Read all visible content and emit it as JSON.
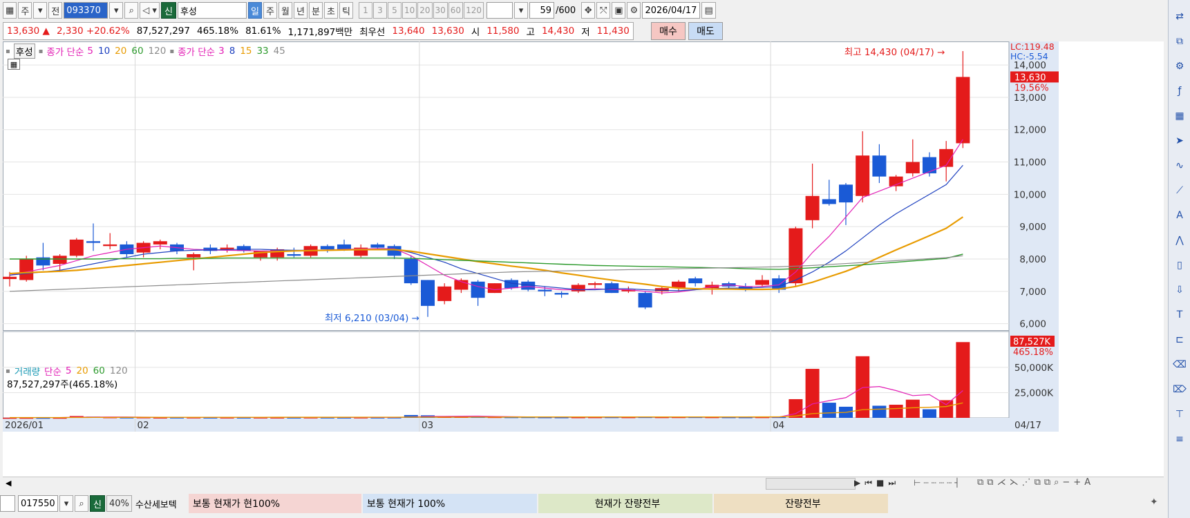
{
  "toolbar": {
    "type_label": "주",
    "prev_label": "전",
    "code": "093370",
    "shin_label": "신",
    "name": "후성",
    "periods": [
      "일",
      "주",
      "월",
      "년",
      "분",
      "초",
      "틱"
    ],
    "active_period": "일",
    "intervals": [
      "1",
      "3",
      "5",
      "10",
      "20",
      "30",
      "60",
      "120"
    ],
    "count": "59",
    "count_max": "/600",
    "date": "2026/04/17"
  },
  "quote": {
    "price": "13,630",
    "arrow": "▲",
    "change": "2,330",
    "change_pct": "+20.62%",
    "volume": "87,527,297",
    "vol_ratio": "465.18%",
    "rate2": "81.61%",
    "amount": "1,171,897백만",
    "best_label": "최우선",
    "ask": "13,640",
    "bid": "13,630",
    "open_label": "시",
    "open": "11,580",
    "high_label": "고",
    "high": "14,430",
    "low_label": "저",
    "low": "11,430",
    "buy_label": "매수",
    "sell_label": "매도"
  },
  "legend": {
    "price_name": "후성",
    "ma_group1_label": "종가 단순",
    "ma_group1": [
      "5",
      "10",
      "20",
      "60",
      "120"
    ],
    "ma_group2_label": "종가 단순",
    "ma_group2": [
      "3",
      "8",
      "15",
      "33",
      "45"
    ],
    "vol_label": "거래량",
    "vol_ma_label": "단순",
    "vol_ma": [
      "5",
      "20",
      "60",
      "120"
    ],
    "vol_info": "87,527,297주(465.18%)"
  },
  "annotations": {
    "high_note": "최고 14,430 (04/17)",
    "low_note": "최저 6,210 (03/04)",
    "lc": "LC:119.48",
    "hc": "HC:-5.54",
    "price_tag": "13,630",
    "price_tag_pct": "19.56%",
    "vol_tag": "87,527K",
    "vol_tag_pct": "465.18%"
  },
  "colors": {
    "up": "#e41b1b",
    "down": "#1a5ad6",
    "ma5": "#e21fb5",
    "ma10": "#1c3fbf",
    "ma20": "#e89b00",
    "ma60": "#2c9a2c",
    "ma120": "#8a8a8a"
  },
  "chart_data": {
    "type": "candlestick",
    "price_axis": {
      "ticks": [
        6000,
        7000,
        8000,
        9000,
        10000,
        11000,
        12000,
        13000,
        14000
      ],
      "range": [
        5800,
        14600
      ]
    },
    "volume_axis": {
      "ticks": [
        "25,000K",
        "50,000K"
      ],
      "tick_values": [
        25000,
        50000
      ],
      "range": [
        0,
        80000
      ]
    },
    "x_labels": [
      "2026/01",
      "02",
      "03",
      "04",
      "04/17"
    ],
    "candles": [
      {
        "o": 7380,
        "h": 7600,
        "l": 7150,
        "c": 7450
      },
      {
        "o": 7350,
        "h": 8100,
        "l": 7300,
        "c": 8000
      },
      {
        "o": 8050,
        "h": 8500,
        "l": 7650,
        "c": 7800
      },
      {
        "o": 7850,
        "h": 8150,
        "l": 7600,
        "c": 8100
      },
      {
        "o": 8100,
        "h": 8650,
        "l": 8050,
        "c": 8600
      },
      {
        "o": 8550,
        "h": 9100,
        "l": 8250,
        "c": 8500
      },
      {
        "o": 8400,
        "h": 8800,
        "l": 8300,
        "c": 8450
      },
      {
        "o": 8450,
        "h": 8550,
        "l": 8050,
        "c": 8150
      },
      {
        "o": 8200,
        "h": 8550,
        "l": 8050,
        "c": 8500
      },
      {
        "o": 8450,
        "h": 8600,
        "l": 8300,
        "c": 8550
      },
      {
        "o": 8450,
        "h": 8500,
        "l": 8150,
        "c": 8250
      },
      {
        "o": 8050,
        "h": 8200,
        "l": 7650,
        "c": 8150
      },
      {
        "o": 8350,
        "h": 8450,
        "l": 8150,
        "c": 8250
      },
      {
        "o": 8300,
        "h": 8450,
        "l": 8200,
        "c": 8350
      },
      {
        "o": 8400,
        "h": 8450,
        "l": 8200,
        "c": 8250
      },
      {
        "o": 8050,
        "h": 8250,
        "l": 7950,
        "c": 8250
      },
      {
        "o": 8050,
        "h": 8350,
        "l": 7950,
        "c": 8300
      },
      {
        "o": 8150,
        "h": 8350,
        "l": 8050,
        "c": 8100
      },
      {
        "o": 8100,
        "h": 8450,
        "l": 8050,
        "c": 8400
      },
      {
        "o": 8400,
        "h": 8450,
        "l": 8200,
        "c": 8300
      },
      {
        "o": 8450,
        "h": 8600,
        "l": 8250,
        "c": 8300
      },
      {
        "o": 8100,
        "h": 8450,
        "l": 8050,
        "c": 8350
      },
      {
        "o": 8450,
        "h": 8500,
        "l": 8300,
        "c": 8350
      },
      {
        "o": 8400,
        "h": 8450,
        "l": 8000,
        "c": 8100
      },
      {
        "o": 8000,
        "h": 8100,
        "l": 7200,
        "c": 7250
      },
      {
        "o": 7350,
        "h": 7350,
        "l": 6210,
        "c": 6550
      },
      {
        "o": 6700,
        "h": 7250,
        "l": 6600,
        "c": 7150
      },
      {
        "o": 7050,
        "h": 7400,
        "l": 6950,
        "c": 7350
      },
      {
        "o": 7300,
        "h": 7350,
        "l": 6550,
        "c": 6800
      },
      {
        "o": 6950,
        "h": 7250,
        "l": 6950,
        "c": 7250
      },
      {
        "o": 7350,
        "h": 7400,
        "l": 7050,
        "c": 7100
      },
      {
        "o": 7300,
        "h": 7350,
        "l": 7000,
        "c": 7050
      },
      {
        "o": 7050,
        "h": 7150,
        "l": 6850,
        "c": 7000
      },
      {
        "o": 6950,
        "h": 7000,
        "l": 6800,
        "c": 6900
      },
      {
        "o": 7000,
        "h": 7250,
        "l": 6950,
        "c": 7200
      },
      {
        "o": 7200,
        "h": 7300,
        "l": 7100,
        "c": 7250
      },
      {
        "o": 7250,
        "h": 7300,
        "l": 6950,
        "c": 6950
      },
      {
        "o": 7000,
        "h": 7150,
        "l": 6950,
        "c": 7050
      },
      {
        "o": 6950,
        "h": 7000,
        "l": 6450,
        "c": 6500
      },
      {
        "o": 7000,
        "h": 7150,
        "l": 6900,
        "c": 7100
      },
      {
        "o": 7100,
        "h": 7350,
        "l": 7000,
        "c": 7300
      },
      {
        "o": 7400,
        "h": 7450,
        "l": 7150,
        "c": 7250
      },
      {
        "o": 7100,
        "h": 7300,
        "l": 6900,
        "c": 7200
      },
      {
        "o": 7250,
        "h": 7300,
        "l": 7050,
        "c": 7150
      },
      {
        "o": 7150,
        "h": 7250,
        "l": 7000,
        "c": 7050
      },
      {
        "o": 7200,
        "h": 7500,
        "l": 7150,
        "c": 7350
      },
      {
        "o": 7400,
        "h": 7500,
        "l": 6950,
        "c": 7050
      },
      {
        "o": 7250,
        "h": 9000,
        "l": 7150,
        "c": 8950
      },
      {
        "o": 9200,
        "h": 10950,
        "l": 8950,
        "c": 9950
      },
      {
        "o": 9850,
        "h": 10450,
        "l": 9650,
        "c": 9700
      },
      {
        "o": 10300,
        "h": 10350,
        "l": 9050,
        "c": 9750
      },
      {
        "o": 9950,
        "h": 11950,
        "l": 9750,
        "c": 11200
      },
      {
        "o": 11200,
        "h": 11550,
        "l": 10350,
        "c": 10550
      },
      {
        "o": 10250,
        "h": 10600,
        "l": 10100,
        "c": 10550
      },
      {
        "o": 10650,
        "h": 11700,
        "l": 10550,
        "c": 11000
      },
      {
        "o": 11150,
        "h": 11300,
        "l": 10550,
        "c": 10650
      },
      {
        "o": 10850,
        "h": 11650,
        "l": 10400,
        "c": 11400
      },
      {
        "o": 11580,
        "h": 14430,
        "l": 11430,
        "c": 13630
      }
    ],
    "volumes": [
      120,
      150,
      130,
      180,
      1800,
      1200,
      700,
      500,
      600,
      400,
      450,
      500,
      400,
      450,
      400,
      450,
      420,
      400,
      500,
      450,
      400,
      500,
      450,
      500,
      2800,
      2500,
      1500,
      1200,
      1000,
      900,
      800,
      850,
      700,
      650,
      700,
      750,
      800,
      750,
      900,
      800,
      850,
      900,
      800,
      750,
      700,
      800,
      900,
      18500,
      48500,
      15000,
      11000,
      61000,
      12000,
      13000,
      18000,
      8500,
      17500,
      75000
    ],
    "ma_lines": {
      "ma5": [
        7500,
        7600,
        7700,
        7800,
        7950,
        8100,
        8200,
        8300,
        8350,
        8400,
        8350,
        8300,
        8280,
        8270,
        8260,
        8250,
        8250,
        8250,
        8270,
        8280,
        8300,
        8310,
        8320,
        8320,
        8100,
        7800,
        7500,
        7300,
        7150,
        7050,
        7100,
        7150,
        7100,
        7050,
        7050,
        7080,
        7060,
        7050,
        7000,
        6950,
        6980,
        7050,
        7150,
        7200,
        7150,
        7150,
        7200,
        7600,
        8200,
        8700,
        9300,
        9900,
        10100,
        10300,
        10500,
        10700,
        10900,
        11700
      ],
      "ma10": [
        7500,
        7550,
        7600,
        7650,
        7750,
        7850,
        7950,
        8050,
        8150,
        8200,
        8250,
        8270,
        8280,
        8290,
        8300,
        8300,
        8280,
        8270,
        8270,
        8270,
        8280,
        8290,
        8300,
        8310,
        8200,
        8050,
        7900,
        7700,
        7550,
        7400,
        7250,
        7200,
        7150,
        7100,
        7050,
        7050,
        7080,
        7080,
        7050,
        7030,
        7020,
        7050,
        7080,
        7100,
        7100,
        7120,
        7150,
        7350,
        7600,
        7900,
        8250,
        8650,
        9050,
        9400,
        9700,
        10000,
        10300,
        10900
      ],
      "ma20": [
        7550,
        7580,
        7600,
        7620,
        7650,
        7700,
        7750,
        7800,
        7850,
        7900,
        7950,
        8000,
        8050,
        8100,
        8150,
        8200,
        8230,
        8250,
        8260,
        8270,
        8280,
        8290,
        8290,
        8290,
        8240,
        8160,
        8080,
        8000,
        7920,
        7850,
        7780,
        7720,
        7650,
        7570,
        7500,
        7420,
        7350,
        7280,
        7220,
        7150,
        7100,
        7080,
        7070,
        7070,
        7060,
        7060,
        7070,
        7150,
        7280,
        7450,
        7620,
        7820,
        8050,
        8280,
        8500,
        8720,
        8950,
        9300
      ],
      "ma60": [
        8000,
        8000,
        8000,
        8000,
        8000,
        8000,
        8010,
        8010,
        8010,
        8010,
        8020,
        8020,
        8020,
        8030,
        8030,
        8030,
        8030,
        8030,
        8030,
        8030,
        8030,
        8030,
        8030,
        8030,
        8020,
        8000,
        7980,
        7960,
        7940,
        7920,
        7900,
        7880,
        7860,
        7840,
        7820,
        7800,
        7790,
        7780,
        7770,
        7760,
        7750,
        7740,
        7730,
        7720,
        7700,
        7690,
        7680,
        7700,
        7730,
        7760,
        7790,
        7820,
        7860,
        7900,
        7940,
        7980,
        8020,
        8150
      ],
      "ma120": [
        7000,
        7020,
        7040,
        7060,
        7080,
        7100,
        7120,
        7140,
        7160,
        7180,
        7200,
        7220,
        7240,
        7260,
        7280,
        7300,
        7320,
        7340,
        7360,
        7380,
        7400,
        7420,
        7440,
        7460,
        7480,
        7500,
        7520,
        7540,
        7560,
        7580,
        7600,
        7610,
        7620,
        7630,
        7640,
        7650,
        7660,
        7670,
        7680,
        7690,
        7700,
        7710,
        7720,
        7730,
        7740,
        7750,
        7760,
        7780,
        7800,
        7830,
        7860,
        7890,
        7920,
        7950,
        7980,
        8010,
        8040,
        8100
      ]
    },
    "vol_ma5": [
      300,
      300,
      300,
      300,
      700,
      800,
      900,
      900,
      700,
      600,
      500,
      500,
      450,
      450,
      440,
      430,
      430,
      430,
      430,
      430,
      430,
      440,
      440,
      450,
      900,
      1300,
      1500,
      1600,
      1700,
      1400,
      1100,
      950,
      850,
      800,
      750,
      750,
      750,
      750,
      800,
      800,
      820,
      840,
      850,
      830,
      800,
      790,
      800,
      4200,
      13800,
      17000,
      20000,
      30000,
      31000,
      27000,
      22000,
      23000,
      13000,
      27000
    ],
    "vol_ma20": [
      300,
      300,
      300,
      300,
      400,
      450,
      500,
      520,
      530,
      540,
      550,
      560,
      560,
      560,
      570,
      580,
      590,
      600,
      600,
      600,
      600,
      620,
      640,
      650,
      700,
      750,
      780,
      800,
      820,
      840,
      850,
      860,
      870,
      880,
      880,
      890,
      890,
      890,
      900,
      900,
      900,
      910,
      920,
      930,
      930,
      940,
      950,
      1800,
      4200,
      4900,
      5400,
      8100,
      8600,
      9200,
      10000,
      10500,
      11200,
      14800
    ]
  },
  "bottom": {
    "code": "017550",
    "shin_label": "신",
    "pct": "40%",
    "name": "수산세보텍",
    "panels": [
      {
        "text": "보통   현재가    현100%",
        "bg": "#f5d5d3"
      },
      {
        "text": "보통   현재가     100%",
        "bg": "#d4e3f5"
      },
      {
        "text": "현재가     잔량전부",
        "bg": "#dde8c8"
      },
      {
        "text": "잔량전부",
        "bg": "#eedfc2"
      }
    ]
  }
}
